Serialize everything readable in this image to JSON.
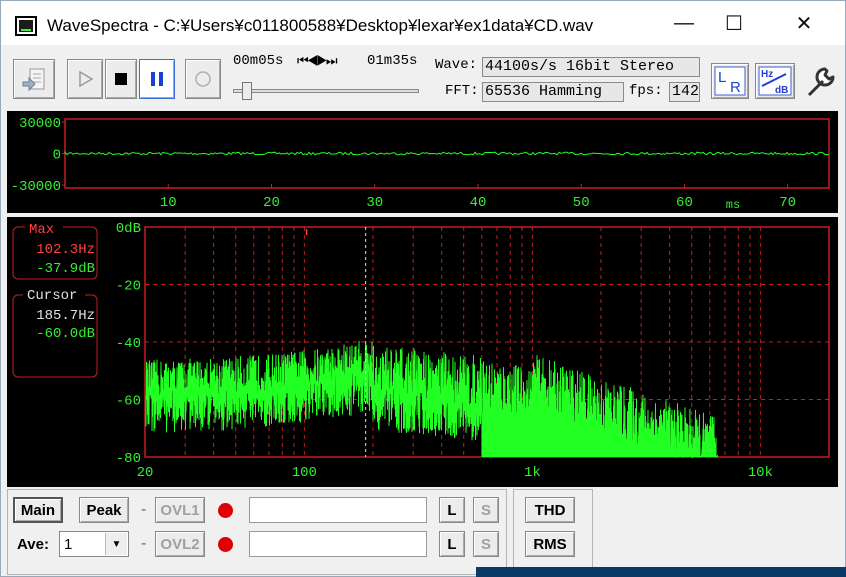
{
  "window": {
    "title": "WaveSpectra - C:¥Users¥c011800588¥Desktop¥lexar¥ex1data¥CD.wav",
    "minimize_glyph": "—",
    "maximize_glyph": "☐",
    "close_glyph": "✕"
  },
  "toolbar": {
    "start_time": "00m05s",
    "seek_controls": "⏮◀▶⏭",
    "end_time": "01m35s",
    "wave_label": "Wave:",
    "wave_value": "44100s/s 16bit Stereo",
    "fft_label": "FFT:",
    "fft_value": "65536 Hamming",
    "fps_label": "fps:",
    "fps_value": "142",
    "lr_label_l": "L",
    "lr_label_r": "R",
    "hz_label": "Hz",
    "db_label": "dB",
    "seek_position": 0.05
  },
  "waveform": {
    "y_ticks": [
      "30000",
      "0",
      "-30000"
    ],
    "x_ticks": [
      "10",
      "20",
      "30",
      "40",
      "50",
      "60",
      "70"
    ],
    "x_unit": "ms",
    "y_range": [
      -32768,
      32767
    ],
    "x_range": [
      0,
      74
    ]
  },
  "spectrum": {
    "y_ticks": [
      "0dB",
      "-20",
      "-40",
      "-60",
      "-80"
    ],
    "x_ticks": [
      "20",
      "100",
      "1k",
      "10k"
    ],
    "max_box": {
      "title": "Max",
      "freq": "102.3Hz",
      "level": "-37.9dB"
    },
    "cursor_box": {
      "title": "Cursor",
      "freq": "185.7Hz",
      "level": "-60.0dB"
    },
    "freq_range": [
      20,
      20000
    ],
    "db_range": [
      -80,
      0
    ],
    "cursor_freq": 185.7,
    "max_freq": 102.3
  },
  "bottom": {
    "main_label": "Main",
    "peak_label": "Peak",
    "ovl1_label": "OVL1",
    "ovl2_label": "OVL2",
    "l_label": "L",
    "s_label": "S",
    "ave_label": "Ave:",
    "ave_value": "1",
    "thd_label": "THD",
    "rms_label": "RMS",
    "dash": "-"
  },
  "colors": {
    "plot_bg": "#000000",
    "axis_red": "#c81e1e",
    "tick_green": "#33ee33",
    "signal_green": "#22ff22",
    "max_red": "#ff4040"
  }
}
